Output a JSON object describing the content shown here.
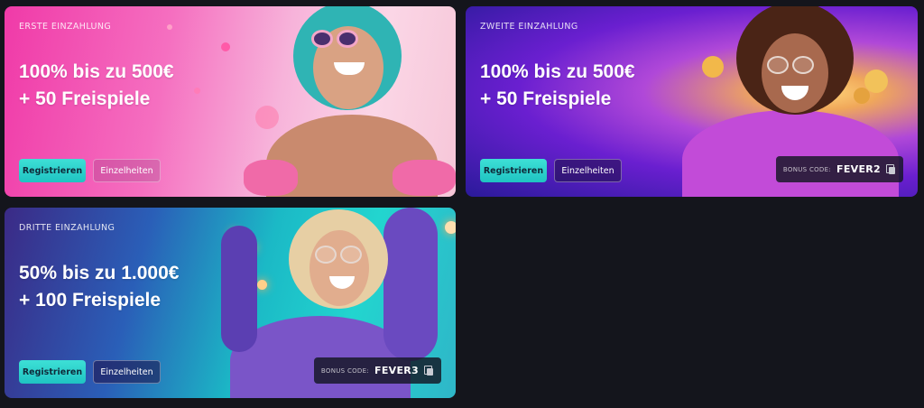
{
  "cards": [
    {
      "eyebrow": "ERSTE EINZAHLUNG",
      "headline_line1": "100% bis zu 500€",
      "headline_line2": "+ 50 Freispiele",
      "primary_button": "Registrieren",
      "secondary_button": "Einzelheiten"
    },
    {
      "eyebrow": "ZWEITE EINZAHLUNG",
      "headline_line1": "100% bis zu 500€",
      "headline_line2": "+ 50 Freispiele",
      "primary_button": "Registrieren",
      "secondary_button": "Einzelheiten",
      "bonus_code_label": "BONUS CODE:",
      "bonus_code_value": "FEVER2"
    },
    {
      "eyebrow": "DRITTE EINZAHLUNG",
      "headline_line1": "50% bis zu 1.000€",
      "headline_line2": "+ 100 Freispiele",
      "primary_button": "Registrieren",
      "secondary_button": "Einzelheiten",
      "bonus_code_label": "BONUS CODE:",
      "bonus_code_value": "FEVER3"
    }
  ],
  "colors": {
    "page_background": "#14151c",
    "primary_button": "#2fd3cc",
    "card1_accent": "#f03aa8",
    "card2_accent": "#6a1fd0",
    "card3_accent": "#1bb9c6"
  }
}
